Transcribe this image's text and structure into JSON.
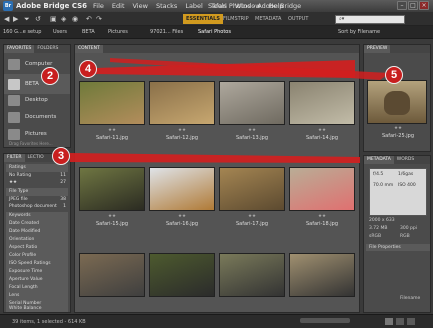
{
  "app": {
    "icon": "Br",
    "name": "Adobe Bridge CS6",
    "window_title": "Safari Photos - Adobe Bridge"
  },
  "menu": [
    "File",
    "Edit",
    "View",
    "Stacks",
    "Label",
    "Tools",
    "Window",
    "Help"
  ],
  "workspaces": [
    "ESSENTIALS",
    "FILMSTRIP",
    "METADATA",
    "OUTPUT"
  ],
  "search": {
    "placeholder": "⌕▾"
  },
  "path": [
    "160 G...e setup",
    "Users",
    "BETA",
    "Pictures",
    "97021... Files",
    "Safari Photos"
  ],
  "sort": "Sort by Filename",
  "panels": {
    "favorites": "FAVORITES",
    "folders": "FOLDERS",
    "filter": "FILTER",
    "collections": "LECTIO",
    "content": "CONTENT",
    "preview": "PREVIEW",
    "metadata": "METADATA",
    "keywords": "WORDS"
  },
  "favorites": [
    {
      "label": "Computer",
      "icon": "computer-icon"
    },
    {
      "label": "BETA",
      "icon": "home-icon"
    },
    {
      "label": "Desktop",
      "icon": "folder-icon"
    },
    {
      "label": "Documents",
      "icon": "folder-icon"
    },
    {
      "label": "Pictures",
      "icon": "folder-icon"
    }
  ],
  "favorites_hint": "Drag Favorites Here...",
  "filter": {
    "ratings_header": "Ratings",
    "ratings": [
      {
        "label": "No Rating",
        "count": "11"
      },
      {
        "label": "★★",
        "count": "27"
      }
    ],
    "file_type_header": "File Type",
    "file_types": [
      {
        "label": "JPEG file",
        "count": "38"
      },
      {
        "label": "Photoshop document",
        "count": "1"
      }
    ],
    "headers": [
      "Keywords",
      "Date Created",
      "Date Modified",
      "Orientation",
      "Aspect Ratio",
      "Color Profile",
      "ISO Speed Ratings",
      "Exposure Time",
      "Aperture Value",
      "Focal Length",
      "Lens",
      "Serial Number",
      "White Balance"
    ]
  },
  "thumbnails": [
    {
      "label": "Safari-11.jpg",
      "stars": "★★",
      "colors": [
        "#6f7a3a",
        "#b38d5c"
      ]
    },
    {
      "label": "Safari-12.jpg",
      "stars": "★★",
      "colors": [
        "#8a7049",
        "#c7a770"
      ]
    },
    {
      "label": "Safari-13.jpg",
      "stars": "★★",
      "colors": [
        "#aea89d",
        "#6f6a60"
      ]
    },
    {
      "label": "Safari-14.jpg",
      "stars": "★★",
      "colors": [
        "#8a8370",
        "#c2bca8"
      ]
    },
    {
      "label": "Safari-15.jpg",
      "stars": "★★",
      "colors": [
        "#6f7642",
        "#2b2b22"
      ]
    },
    {
      "label": "Safari-16.jpg",
      "stars": "★★",
      "colors": [
        "#dfe3e8",
        "#b07a36"
      ]
    },
    {
      "label": "Safari-17.jpg",
      "stars": "★★",
      "colors": [
        "#a48552",
        "#5c4a30"
      ]
    },
    {
      "label": "Safari-18.jpg",
      "stars": "★★",
      "colors": [
        "#b9ad96",
        "#e07070"
      ]
    },
    {
      "label": "",
      "stars": "",
      "colors": [
        "#7b6a52",
        "#3f3f3f"
      ]
    },
    {
      "label": "",
      "stars": "",
      "colors": [
        "#4d5a2e",
        "#2b2b2b"
      ]
    },
    {
      "label": "",
      "stars": "",
      "colors": [
        "#7a7a5a",
        "#333"
      ]
    },
    {
      "label": "",
      "stars": "",
      "colors": [
        "#a09070",
        "#333"
      ]
    }
  ],
  "preview": {
    "label": "Safari-25.jpg",
    "stars": "★★"
  },
  "metadata": {
    "aperture": "f/4.5",
    "shutter": "1/6gas",
    "focal": "70.0 mm",
    "iso": "ISO 400",
    "dims": "2000 x 633",
    "size": "3.72 MB",
    "res": "300 ppi",
    "profile": "sRGB",
    "mode": "RGB",
    "section": "File Properties",
    "filename_label": "Filename"
  },
  "status": "39 items, 1 selected - 614 KB",
  "callouts": [
    "2",
    "3",
    "4",
    "5"
  ],
  "colors": {
    "accent": "#d19a1f",
    "callout": "#c81f1f",
    "arrow": "#d21f1f"
  }
}
